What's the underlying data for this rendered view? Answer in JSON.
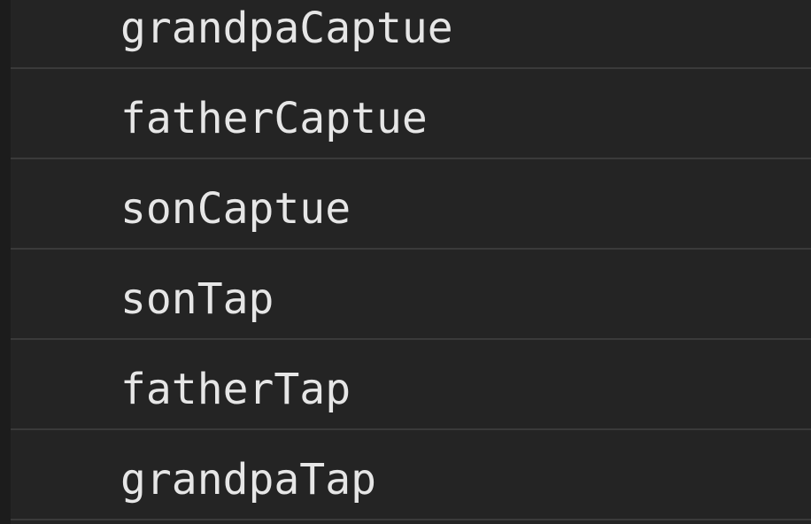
{
  "console": {
    "messages": [
      {
        "text": "grandpaCaptue"
      },
      {
        "text": "fatherCaptue"
      },
      {
        "text": "sonCaptue"
      },
      {
        "text": "sonTap"
      },
      {
        "text": "fatherTap"
      },
      {
        "text": "grandpaTap"
      }
    ]
  },
  "colors": {
    "background": "#242424",
    "text": "#e6e6e6",
    "divider": "#3a3a3a"
  }
}
